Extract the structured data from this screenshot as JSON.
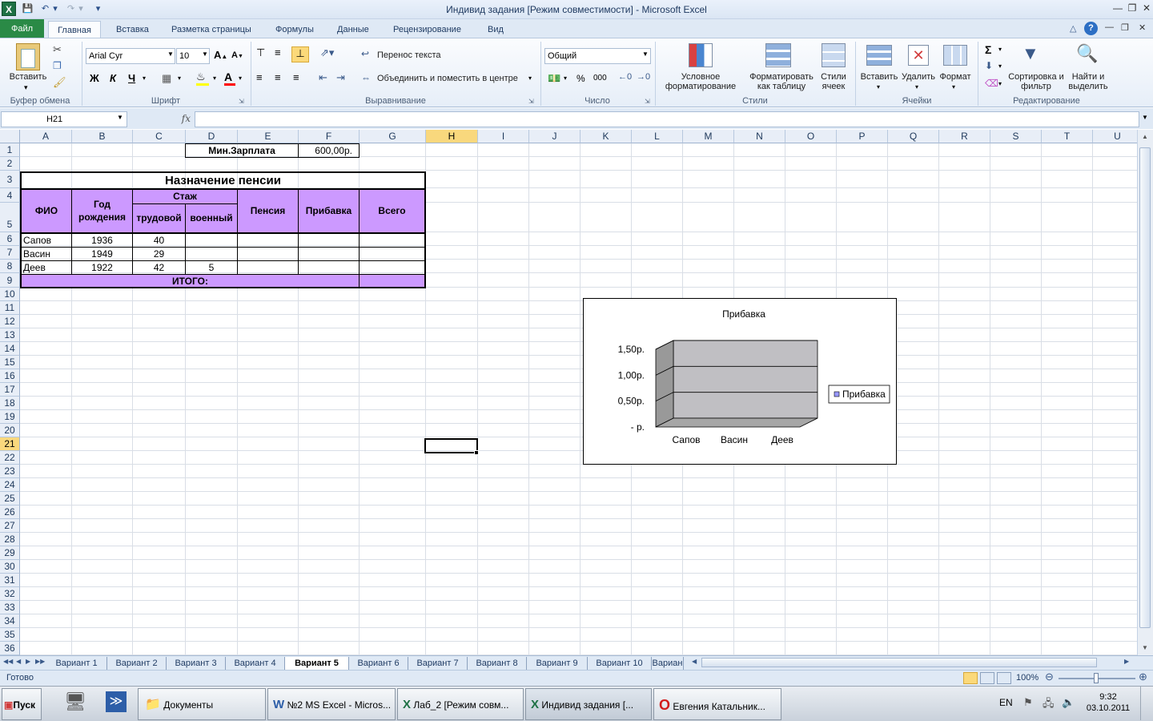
{
  "window": {
    "title": "Индивид задания  [Режим совместимости]  -  Microsoft Excel"
  },
  "ribbon_tabs": [
    "Файл",
    "Главная",
    "Вставка",
    "Разметка страницы",
    "Формулы",
    "Данные",
    "Рецензирование",
    "Вид"
  ],
  "ribbon": {
    "clipboard": {
      "paste": "Вставить",
      "group": "Буфер обмена"
    },
    "font": {
      "name": "Arial Cyr",
      "size": "10",
      "bold": "Ж",
      "italic": "К",
      "underline": "Ч",
      "group": "Шрифт"
    },
    "alignment": {
      "wrap": "Перенос текста",
      "merge": "Объединить и поместить в центре",
      "group": "Выравнивание"
    },
    "number": {
      "format": "Общий",
      "percent": "%",
      "thousands": "000",
      "group": "Число"
    },
    "styles": {
      "conditional": "Условное форматирование",
      "as_table": "Форматировать как таблицу",
      "cell_styles": "Стили ячеек",
      "group": "Стили"
    },
    "cells": {
      "insert": "Вставить",
      "delete": "Удалить",
      "format": "Формат",
      "group": "Ячейки"
    },
    "editing": {
      "sort": "Сортировка и фильтр",
      "find": "Найти и выделить",
      "group": "Редактирование"
    }
  },
  "formula_bar": {
    "name_box": "H21",
    "fx": "fx",
    "value": ""
  },
  "columns": [
    "A",
    "B",
    "C",
    "D",
    "E",
    "F",
    "G",
    "H",
    "I",
    "J",
    "K",
    "L",
    "M",
    "N",
    "O",
    "P",
    "Q",
    "R",
    "S",
    "T",
    "U"
  ],
  "rows": [
    "1",
    "2",
    "3",
    "4",
    "5",
    "6",
    "7",
    "8",
    "9",
    "10",
    "11",
    "12",
    "13",
    "14",
    "15",
    "16",
    "17",
    "18",
    "19",
    "20",
    "21",
    "22",
    "23",
    "24",
    "25",
    "26",
    "27",
    "28",
    "29",
    "30",
    "31",
    "32",
    "33",
    "34",
    "35",
    "36"
  ],
  "sheet": {
    "min_salary_label": "Мин.Зарплата",
    "min_salary_value": "600,00р.",
    "table_title": "Назначение пенсии",
    "headers": {
      "fio": "ФИО",
      "birth_year": "Год рождения",
      "experience": "Стаж",
      "labor": "трудовой",
      "military": "военный",
      "pension": "Пенсия",
      "bonus": "Прибавка",
      "total": "Всего"
    },
    "data_rows": [
      {
        "fio": "Сапов",
        "year": "1936",
        "labor": "40",
        "military": ""
      },
      {
        "fio": "Васин",
        "year": "1949",
        "labor": "29",
        "military": ""
      },
      {
        "fio": "Деев",
        "year": "1922",
        "labor": "42",
        "military": "5"
      }
    ],
    "total_label": "ИТОГО:"
  },
  "chart_data": {
    "type": "bar",
    "title": "Прибавка",
    "categories": [
      "Сапов",
      "Васин",
      "Деев"
    ],
    "series": [
      {
        "name": "Прибавка",
        "values": [
          0,
          0,
          0
        ]
      }
    ],
    "y_tick_labels": [
      "-  р.",
      "0,50р.",
      "1,00р.",
      "1,50р."
    ],
    "ylim": [
      0,
      1.5
    ],
    "grid": true,
    "legend": "right"
  },
  "sheet_tabs": [
    "Вариант 1",
    "Вариант 2",
    "Вариант 3",
    "Вариант 4",
    "Вариант 5",
    "Вариант 6",
    "Вариант 7",
    "Вариант 8",
    "Вариант 9",
    "Вариант 10",
    "Вариан"
  ],
  "active_sheet": "Вариант 5",
  "status": {
    "ready": "Готово",
    "zoom": "100%"
  },
  "taskbar": {
    "start": "Пуск",
    "buttons": [
      "Документы",
      "№2 MS Excel - Micros...",
      "Лаб_2  [Режим совм...",
      "Индивид задания  [...",
      "Евгения Катальник..."
    ],
    "lang": "EN",
    "time": "9:32",
    "date": "03.10.2011"
  }
}
